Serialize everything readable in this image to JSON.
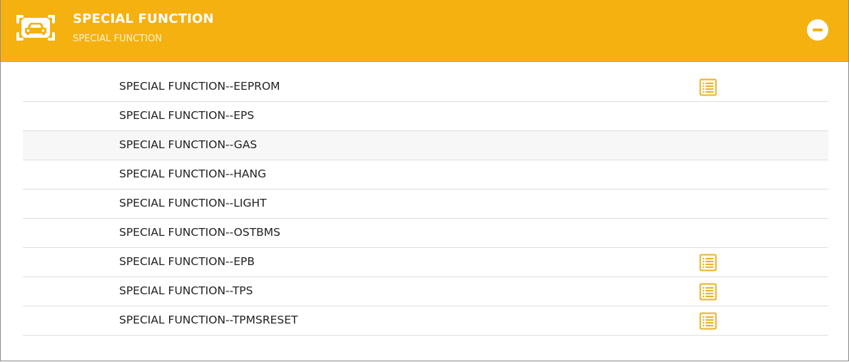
{
  "header": {
    "title": "SPECIAL FUNCTION",
    "subtitle": "SPECIAL FUNCTION",
    "icon": "car-icon",
    "collapse_icon": "minus-circle-icon",
    "background_color": "#f5b110"
  },
  "rows": [
    {
      "label": "SPECIAL FUNCTION--EEPROM",
      "has_doc_icon": true,
      "shaded": false
    },
    {
      "label": "SPECIAL FUNCTION--EPS",
      "has_doc_icon": false,
      "shaded": false
    },
    {
      "label": "SPECIAL FUNCTION--GAS",
      "has_doc_icon": false,
      "shaded": true
    },
    {
      "label": "SPECIAL FUNCTION--HANG",
      "has_doc_icon": false,
      "shaded": false
    },
    {
      "label": "SPECIAL FUNCTION--LIGHT",
      "has_doc_icon": false,
      "shaded": false
    },
    {
      "label": "SPECIAL FUNCTION--OSTBMS",
      "has_doc_icon": false,
      "shaded": false
    },
    {
      "label": "SPECIAL FUNCTION--EPB",
      "has_doc_icon": true,
      "shaded": false
    },
    {
      "label": "SPECIAL FUNCTION--TPS",
      "has_doc_icon": true,
      "shaded": false
    },
    {
      "label": "SPECIAL FUNCTION--TPMSRESET",
      "has_doc_icon": true,
      "shaded": false
    }
  ],
  "doc_icon": "document-list-icon",
  "doc_icon_color": "#e7b32c"
}
